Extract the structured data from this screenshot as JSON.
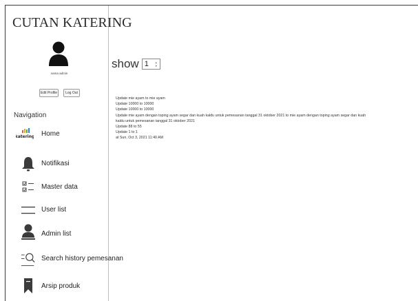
{
  "sidebar": {
    "brand": "CUTAN KATERING",
    "admin_name": "nama admin",
    "edit_profile_label": "Edit Profile",
    "logout_label": "Log Out",
    "nav_heading": "Navigation",
    "items": [
      {
        "label": "Home",
        "icon": "katering-logo-icon"
      },
      {
        "label": "Notifikasi",
        "icon": "bell-icon"
      },
      {
        "label": "Master data",
        "icon": "checklist-icon"
      },
      {
        "label": "User list",
        "icon": "list-lines-icon"
      },
      {
        "label": "Admin list",
        "icon": "admin-person-icon"
      },
      {
        "label": "Search history pemesanan",
        "icon": "search-list-icon"
      },
      {
        "label": "Arsip produk",
        "icon": "bookmark-icon"
      }
    ],
    "home_logo_text": "katering"
  },
  "main": {
    "show_label": "show",
    "show_value": "1",
    "log_lines": [
      "Update mie ayam to mie ayam",
      "Update 10000 to 10000",
      "Update 10000 to 10000",
      "Update mie ayam dengan toping ayam segar dan kuah kaldu untuk pemesanan tanggal 31 oktober 2021 to mie ayam dengan toping ayam segar dan kuah",
      "kaldu untuk pemesanan tanggal 31 oktober 2021",
      "Update 88 to 55",
      "Update 1 to 1",
      "at Sun, Oct 3, 2021 11:40 AM"
    ]
  },
  "colors": {
    "sidebar_border": "#9ec9dd",
    "icon_dark": "#3b3b3b"
  }
}
